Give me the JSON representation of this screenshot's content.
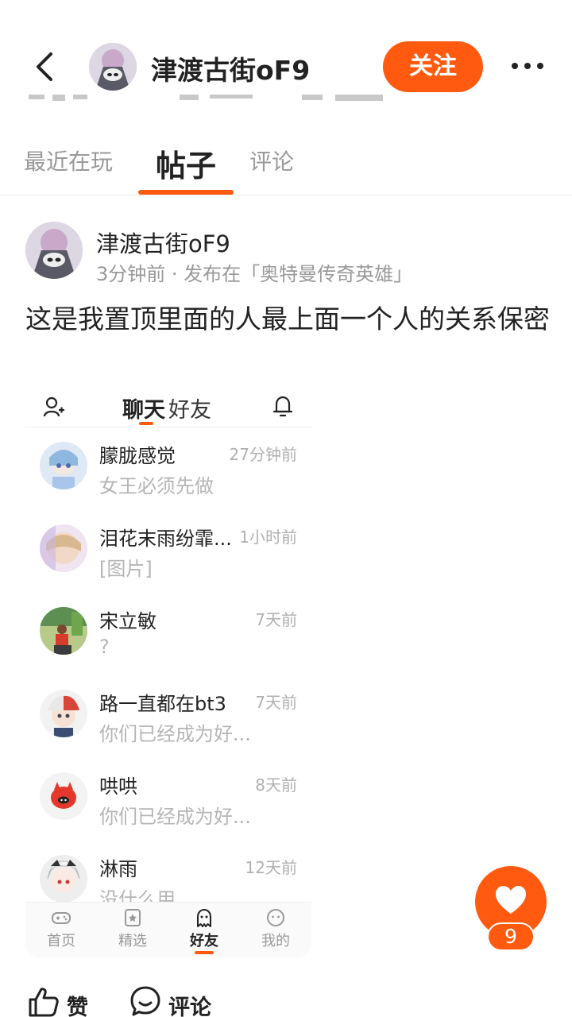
{
  "header": {
    "title": "津渡古街oF9",
    "follow_label": "关注",
    "accent": "#ff5a0f"
  },
  "tabs": [
    {
      "label": "最近在玩"
    },
    {
      "label": "帖子"
    },
    {
      "label": "评论"
    }
  ],
  "post": {
    "author": "津渡古街oF9",
    "meta": "3分钟前 · 发布在「奥特曼传奇英雄」",
    "text": "这是我置顶里面的人最上面一个人的关系保密"
  },
  "screenshot": {
    "tab_chat": "聊天",
    "tab_friends": "好友",
    "messages": [
      {
        "name": "朦胧感觉",
        "time": "27分钟前",
        "preview": "女王必须先做"
      },
      {
        "name": "泪花末雨纷霏...",
        "time": "1小时前",
        "preview": "[图片]"
      },
      {
        "name": "宋立敏",
        "time": "7天前",
        "preview": "?"
      },
      {
        "name": "路一直都在bt3",
        "time": "7天前",
        "preview": "你们已经成为好..."
      },
      {
        "name": "哄哄",
        "time": "8天前",
        "preview": "你们已经成为好..."
      },
      {
        "name": "淋雨",
        "time": "12天前",
        "preview": "没什么用"
      }
    ],
    "nav": [
      {
        "label": "首页",
        "icon": "gamepad-icon"
      },
      {
        "label": "精选",
        "icon": "star-badge-icon"
      },
      {
        "label": "好友",
        "icon": "ghost-icon"
      },
      {
        "label": "我的",
        "icon": "face-icon"
      }
    ]
  },
  "like": {
    "count": "9"
  },
  "actions": {
    "like_label": "赞",
    "comment_label": "评论"
  }
}
